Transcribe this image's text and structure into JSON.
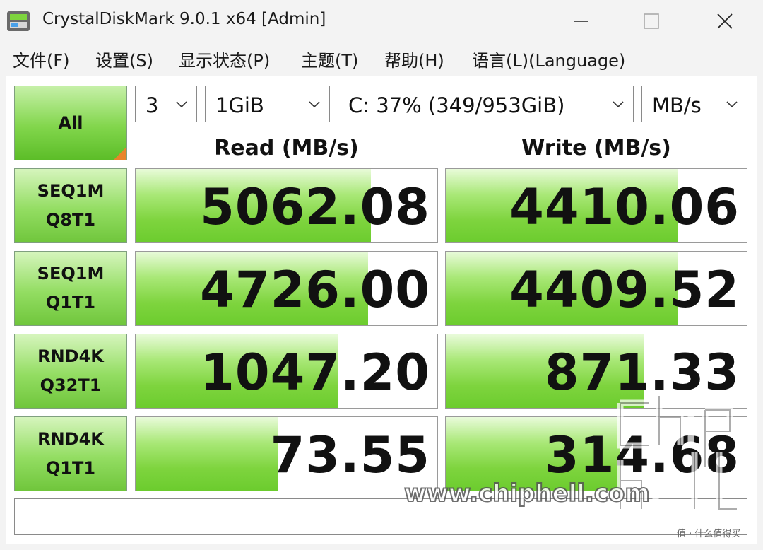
{
  "window": {
    "title": "CrystalDiskMark 9.0.1 x64 [Admin]"
  },
  "menu": [
    "文件(F)",
    "设置(S)",
    "显示状态(P)",
    "主题(T)",
    "帮助(H)",
    "语言(L)(Language)"
  ],
  "controls": {
    "all_label": "All",
    "count": "3",
    "size": "1GiB",
    "drive": "C: 37% (349/953GiB)",
    "unit": "MB/s"
  },
  "headers": {
    "read": "Read (MB/s)",
    "write": "Write (MB/s)"
  },
  "rows": [
    {
      "line1": "SEQ1M",
      "line2": "Q8T1",
      "read": "5062.08",
      "write": "4410.06",
      "read_fill": 0.78,
      "write_fill": 0.77
    },
    {
      "line1": "SEQ1M",
      "line2": "Q1T1",
      "read": "4726.00",
      "write": "4409.52",
      "read_fill": 0.77,
      "write_fill": 0.77
    },
    {
      "line1": "RND4K",
      "line2": "Q32T1",
      "read": "1047.20",
      "write": "871.33",
      "read_fill": 0.67,
      "write_fill": 0.66
    },
    {
      "line1": "RND4K",
      "line2": "Q1T1",
      "read": "73.55",
      "write": "314.68",
      "read_fill": 0.47,
      "write_fill": 0.58
    }
  ],
  "status_text": "",
  "watermark": {
    "site": "www.chiphell.com",
    "logo_text": "chip hell",
    "source": "值 · 什么值得买"
  },
  "colors": {
    "accent_green": "#7ed43e",
    "corner_orange": "#e8842a"
  }
}
